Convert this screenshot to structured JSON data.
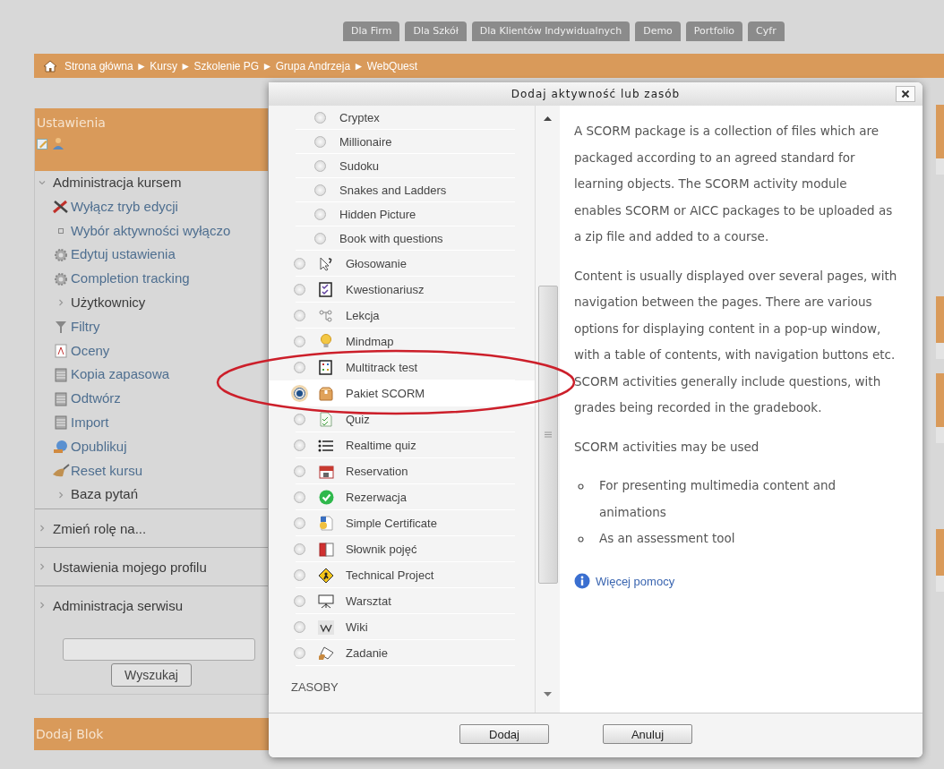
{
  "top_tabs": [
    "Dla Firm",
    "Dla Szkół",
    "Dla Klientów Indywidualnych",
    "Demo",
    "Portfolio",
    "Cyfr"
  ],
  "breadcrumb": "Strona główna ► Kursy ► Szkolenie PG ► Grupa Andrzeja ► WebQuest",
  "settings_block": {
    "title": "Ustawienia",
    "items": [
      {
        "label": "Administracja kursem",
        "kind": "group",
        "expanded": true,
        "children": [
          {
            "label": "Wyłącz tryb edycji",
            "kind": "link"
          },
          {
            "label": "Wybór aktywności wyłączo",
            "kind": "bullet"
          },
          {
            "label": "Edytuj ustawienia",
            "kind": "link"
          },
          {
            "label": "Completion tracking",
            "kind": "link"
          },
          {
            "label": "Użytkownicy",
            "kind": "group",
            "expanded": false
          },
          {
            "label": "Filtry",
            "kind": "link"
          },
          {
            "label": "Oceny",
            "kind": "link"
          },
          {
            "label": "Kopia zapasowa",
            "kind": "link"
          },
          {
            "label": "Odtwórz",
            "kind": "link"
          },
          {
            "label": "Import",
            "kind": "link"
          },
          {
            "label": "Opublikuj",
            "kind": "link"
          },
          {
            "label": "Reset kursu",
            "kind": "link"
          },
          {
            "label": "Baza pytań",
            "kind": "group",
            "expanded": false
          }
        ]
      }
    ],
    "sections": [
      {
        "label": "Zmień rolę na...",
        "expanded": false
      },
      {
        "label": "Ustawienia mojego profilu",
        "expanded": false
      },
      {
        "label": "Administracja serwisu",
        "expanded": false
      }
    ],
    "search_button": "Wyszukaj"
  },
  "add_block": {
    "title": "Dodaj Blok"
  },
  "dialog": {
    "title": "Dodaj aktywność lub zasób",
    "activities": [
      {
        "label": "Cryptex",
        "kind": "sub",
        "selected": false
      },
      {
        "label": "Millionaire",
        "kind": "sub",
        "selected": false
      },
      {
        "label": "Sudoku",
        "kind": "sub",
        "selected": false
      },
      {
        "label": "Snakes and Ladders",
        "kind": "sub",
        "selected": false
      },
      {
        "label": "Hidden Picture",
        "kind": "sub",
        "selected": false
      },
      {
        "label": "Book with questions",
        "kind": "sub",
        "selected": false
      },
      {
        "label": "Głosowanie",
        "kind": "module",
        "selected": false
      },
      {
        "label": "Kwestionariusz",
        "kind": "module",
        "selected": false
      },
      {
        "label": "Lekcja",
        "kind": "module",
        "selected": false
      },
      {
        "label": "Mindmap",
        "kind": "module",
        "selected": false
      },
      {
        "label": "Multitrack test",
        "kind": "module",
        "selected": false
      },
      {
        "label": "Pakiet SCORM",
        "kind": "module",
        "selected": true
      },
      {
        "label": "Quiz",
        "kind": "module",
        "selected": false
      },
      {
        "label": "Realtime quiz",
        "kind": "module",
        "selected": false
      },
      {
        "label": "Reservation",
        "kind": "module",
        "selected": false
      },
      {
        "label": "Rezerwacja",
        "kind": "module",
        "selected": false
      },
      {
        "label": "Simple Certificate",
        "kind": "module",
        "selected": false
      },
      {
        "label": "Słownik pojęć",
        "kind": "module",
        "selected": false
      },
      {
        "label": "Technical Project",
        "kind": "module",
        "selected": false
      },
      {
        "label": "Warsztat",
        "kind": "module",
        "selected": false
      },
      {
        "label": "Wiki",
        "kind": "module",
        "selected": false
      },
      {
        "label": "Zadanie",
        "kind": "module",
        "selected": false
      }
    ],
    "section_heading": "ZASOBY",
    "description": {
      "paragraphs": [
        "A SCORM package is a collection of files which are packaged according to an agreed standard for learning objects. The SCORM activity module enables SCORM or AICC packages to be uploaded as a zip file and added to a course.",
        "Content is usually displayed over several pages, with navigation between the pages. There are various options for displaying content in a pop-up window, with a table of contents, with navigation buttons etc. SCORM activities generally include questions, with grades being recorded in the gradebook.",
        "SCORM activities may be used"
      ],
      "uses": [
        "For presenting multimedia content and animations",
        "As an assessment tool"
      ],
      "help_link": "Więcej pomocy"
    },
    "buttons": [
      "Dodaj",
      "Anuluj"
    ]
  }
}
